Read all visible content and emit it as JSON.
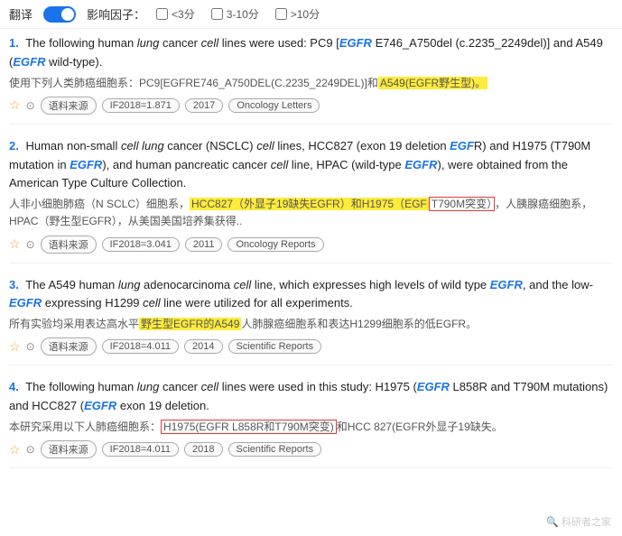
{
  "topbar": {
    "translate_label": "翻译",
    "toggle_state": "on",
    "impact_label": "影响因子：",
    "filters": [
      {
        "id": "f1",
        "label": "<3分",
        "checked": false
      },
      {
        "id": "f2",
        "label": "3-10分",
        "checked": false
      },
      {
        "id": "f3",
        "label": ">10分",
        "checked": false
      }
    ]
  },
  "results": [
    {
      "index": 1,
      "en": {
        "pre": "The following human ",
        "lung": "lung",
        "mid1": " cancer ",
        "cell1": "cell",
        "mid2": " lines were used: PC9 [",
        "egfr1": "EGFR",
        "mid3": " E746_A750del (c.2235_2249del)] and A549 (",
        "egfr2": "EGFR",
        "end": " wild-type)."
      },
      "cn_pre": "使用下列人类肺癌细胞系：PC9[EGFRE746_A750DEL(C.2235_2249DEL)]和",
      "cn_highlight": "A549(EGFR野生型)。",
      "cn_end": "",
      "meta": {
        "source_label": "语料来源",
        "if_label": "IF2018=1.871",
        "year": "2017",
        "journal": "Oncology Letters"
      }
    },
    {
      "index": 2,
      "en": {
        "pre": "Human non-small ",
        "cell1": "cell",
        "mid1": " ",
        "lung": "lung",
        "mid2": " cancer (NSCLC) ",
        "cell2": "cell",
        "mid3": " lines, HCC827 (exon 19 deletion ",
        "egfr1": "EGF",
        "mid4": "R) and H1975 (T790M mutation in ",
        "egfr2": "EGFR",
        "end": "), and human pancreatic cancer ",
        "cell3": "cell",
        "end2": " line, HPAC (wild-type ",
        "egfr3": "EGFR",
        "end3": "), were obtained from the American Type Culture Collection."
      },
      "cn_pre": "人非小细胞肺癌（N SCLC）细胞系，",
      "cn_highlight1": "HCC827（外显子19缺失EGFR）和H1975（EGF",
      "cn_highlight2": "T790M突变）",
      "cn_end": "，人胰腺癌细胞系，HPAC（野生型EGFR），从美国美国培养集获得..",
      "meta": {
        "source_label": "语料来源",
        "if_label": "IF2018=3.041",
        "year": "2011",
        "journal": "Oncology Reports"
      }
    },
    {
      "index": 3,
      "en": {
        "pre": "The A549 human ",
        "lung": "lung",
        "mid1": " adenocarcinoma ",
        "cell1": "cell",
        "mid2": " line, which expresses high levels of wild type ",
        "egfr1": "EGFR",
        "mid3": ", and the low-",
        "egfr2": "EGFR",
        "mid4": " expressing H1299 ",
        "cell2": "cell",
        "end": " line were utilized for all experiments."
      },
      "cn_pre": "所有实验均采用表达高水平",
      "cn_highlight": "野生型EGFR的A549",
      "cn_end": "人肺腺癌细胞系和表达H1299细胞系的低EGFR。",
      "meta": {
        "source_label": "语料来源",
        "if_label": "IF2018=4.011",
        "year": "2014",
        "journal": "Scientific Reports"
      }
    },
    {
      "index": 4,
      "en": {
        "pre": "The following human ",
        "lung": "lung",
        "mid1": " cancer ",
        "cell1": "cell",
        "mid2": " lines were used in this study: H1975 (",
        "egfr1": "EGFR",
        "mid3": " L858R and T790M mutations) and HCC827 (",
        "egfr2": "EGFR",
        "end": " exon 19 deletion."
      },
      "cn_pre": "本研究采用以下人肺癌细胞系：",
      "cn_highlight": "H1975(EGFR L858R和T790M突变)",
      "cn_end": "和HCC 827(EGFR外显子19缺失。",
      "meta": {
        "source_label": "语料来源",
        "if_label": "IF2018=4.011",
        "year": "2018",
        "journal": "Scientific Reports"
      }
    }
  ],
  "watermark": "科研者之家"
}
